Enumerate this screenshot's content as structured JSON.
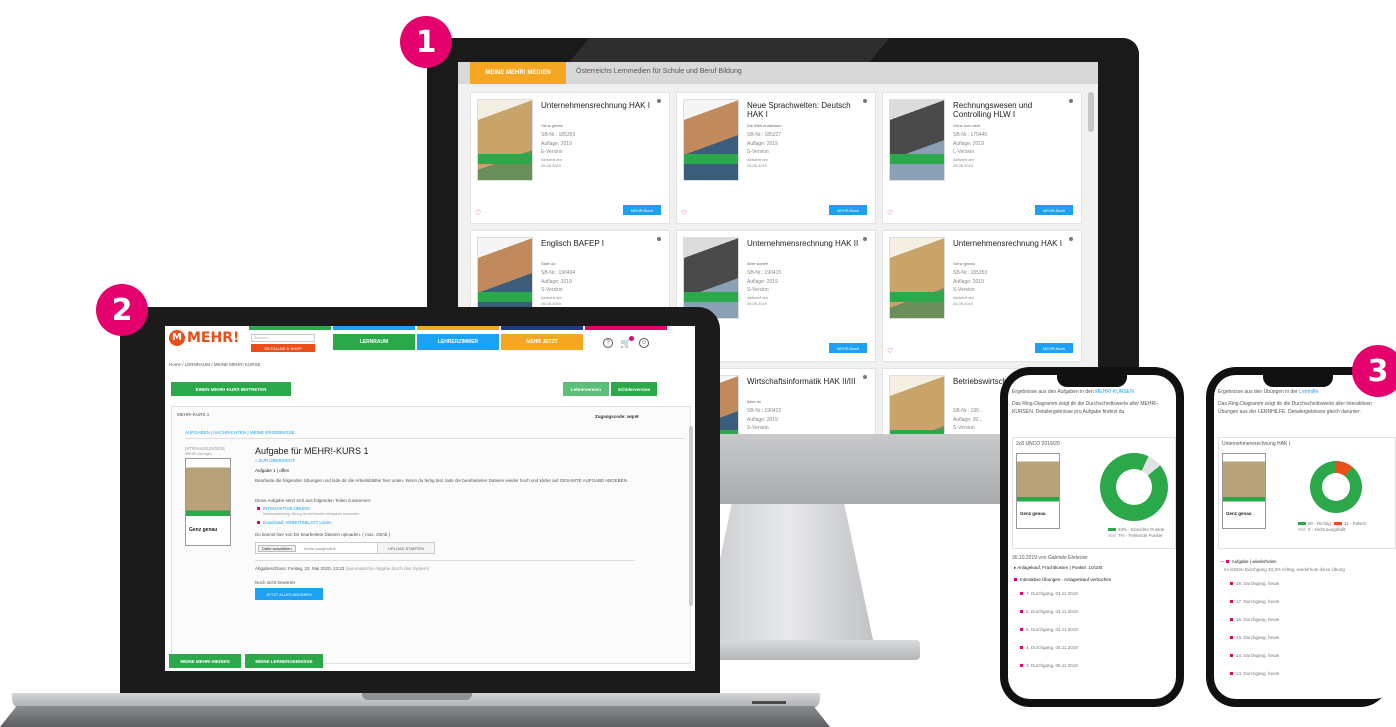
{
  "badges": [
    "1",
    "2",
    "3"
  ],
  "colors": {
    "accent_magenta": "#e4006d",
    "brand_orange": "#e94e1b",
    "green": "#2aa84a",
    "blue": "#1da1f2",
    "yellow": "#f5a623",
    "navy": "#1e3a8a",
    "pink": "#e4006d"
  },
  "monitor": {
    "tab_label": "MEINE MEHR! MEDIEN",
    "tab_text": "Österreichs Lernmedien für Schule und Beruf Bildung",
    "cards": [
      {
        "title": "Unternehmensrechnung HAK I",
        "subtitle": "Genz genau",
        "sbnr": "SB-Nr.: 185353",
        "auflage": "Auflage: 2019",
        "version": "E-Version",
        "aktiviert": "Aktiviert am",
        "date": "26.06.2019",
        "button": "MEHR-Buch",
        "cover": "teal"
      },
      {
        "title": "Neue Sprachwelten: Deutsch HAK I",
        "subtitle": "Die Welt entdecken",
        "sbnr": "SB-Nr.: 185227",
        "auflage": "Auflage: 2019",
        "version": "S-Version",
        "aktiviert": "Aktiviert am",
        "date": "26.06.2019",
        "button": "MEHR-Buch",
        "cover": "people"
      },
      {
        "title": "Rechnungswesen und Controlling HLW I",
        "subtitle": "Genz und mehr",
        "sbnr": "SB-Nr.: 175445",
        "auflage": "Auflage: 2019",
        "version": "L-Version",
        "aktiviert": "Aktiviert am",
        "date": "26.06.2019",
        "button": "MEHR-Buch",
        "cover": "dark"
      },
      {
        "title": "Englisch BAFEP I",
        "subtitle": "Start Up",
        "sbnr": "SB-Nr.: 190404",
        "auflage": "Auflage: 2019",
        "version": "S-Version",
        "aktiviert": "Aktiviert am",
        "date": "26.06.2019",
        "button": "",
        "cover": "people"
      },
      {
        "title": "Unternehmensrechnung HAK II",
        "subtitle": "Aber sicher!",
        "sbnr": "SB-Nr.: 190415",
        "auflage": "Auflage: 2019",
        "version": "S-Version",
        "aktiviert": "Aktiviert am",
        "date": "26.06.2019",
        "button": "MEHR-Buch",
        "cover": "dark"
      },
      {
        "title": "Unternehmensrechnung HAK I",
        "subtitle": "Genz genau",
        "sbnr": "SB-Nr.: 185353",
        "auflage": "Auflage: 2019",
        "version": "S-Version",
        "aktiviert": "Aktiviert am",
        "date": "26.06.2019",
        "button": "MEHR-Buch",
        "cover": "teal"
      },
      {
        "title": "",
        "subtitle": "",
        "sbnr": "",
        "auflage": "",
        "version": "",
        "aktiviert": "",
        "date": "",
        "button": "",
        "cover": "dark"
      },
      {
        "title": "Wirtschaftsinformatik HAK II/III",
        "subtitle": "Alles ist",
        "sbnr": "SB-Nr.: 190422",
        "auflage": "Auflage: 2019",
        "version": "S-Version",
        "aktiviert": "",
        "date": "",
        "button": "",
        "cover": "people"
      },
      {
        "title": "Betriebswirtschaft ...",
        "subtitle": "",
        "sbnr": "SB-Nr.: 190...",
        "auflage": "Auflage: 20...",
        "version": "S-Version",
        "aktiviert": "Aktiviert am",
        "date": "22.06.2019",
        "button": "",
        "cover": "teal"
      }
    ]
  },
  "laptop": {
    "logo": "MEHR!",
    "logo_mark": "M",
    "search_placeholder": "Suchen...",
    "shop_button": "SB-FALLBE & SHOP",
    "nav": [
      "LERNRAUM",
      "LEHRERZIMMER",
      "MEHR JETZT"
    ],
    "breadcrumb": "Home / LERNRAUM / MEINE MEHR! KURSE",
    "join_button": "EINEN MEHR!-KURS BEITRETEN",
    "toggle_left": "Lehrerversion",
    "toggle_right": "Schülerversion",
    "course_name": "MEHR!-KURS 1",
    "access_code": "Zugangscode: wqn9",
    "subtabs": "AUFGABEN | NACHRICHTEN | MEINE ERGEBNISSE",
    "img_alt": "[STRAHLEUNGEN]",
    "img_sub": "MEHR!-Übungen",
    "task_title": "Aufgabe für MEHR!-KURS 1",
    "back_link": "« ZUR ÜBERSICHT",
    "task_status": "Aufgabe 1 | offen",
    "task_desc": "Bearbeite die folgenden Übungen und lade dir die Arbeitsblätter hier unten. Wenn du fertig bist, lade die bearbeiteten Dateien wieder hoch und klicke auf GESAMTE AUFGABE ABGEBEN.",
    "task_parts": "Diese Aufgabe setzt sich aus folgenden Teilen zusammen:",
    "part1": "INTERAKTIVE ÜBUNG",
    "part1_sub": "Nachbearbeitung: Übung ist dort bereits erfolgreich bearbeitet",
    "part2": "Download: ARBEITSBLATT Lösen",
    "upload_hint": "Du kannst hier von Dir bearbeitete Dateien uploaden. ( max. 20mb )",
    "file_button": "Datei auswählen",
    "file_value": "Keine ausgewählt",
    "upload_button": "UPLOAD STARTEN",
    "due": "Abgabeschluss: Freitag, 22. Mai 2020, 13:23",
    "due_note": "(automatische Abgabe durch das System)",
    "graded": "Noch nicht bewertet",
    "submit_button": "JETZT ALLES ABGEBEN",
    "bottom_buttons": [
      "MEINE MEHR!-MEDIEN",
      "MEINE LERNERGEBNISSE"
    ],
    "cover_title": "Genz genau"
  },
  "phone1": {
    "header": "Ergebnisse aus den Aufgaben in den",
    "header_link": "MEHR!-KURSEN",
    "intro": "Das Ring-Diagramm zeigt dir die Durchschnittswerte aller MEHR!-KURSEN. Detailergebnisse pro Aufgabe findest du",
    "section": "2c8 UNCO 2019/20",
    "legend1": "93% - Erreichte Punkte",
    "legend2": "7% - Fehlende Punkte",
    "cover_title": "Genz genau",
    "teacher_line": "30.10.2019 von Gabriele Ehrlecier",
    "task": "Anlagekauf, Frachtkosten",
    "task_points": "Punkte: 10/100",
    "exercise": "Interaktive Übungen - Anlagenkauf verbuchen",
    "percent_green": 93,
    "durchgaenge": [
      "7. Durchgang, 04.11.2019",
      "6. Durchgang, 04.11.2019",
      "5. Durchgang, 04.11.2019",
      "4. Durchgang, 04.11.2019",
      "3. Durchgang, 06.11.2019"
    ]
  },
  "phone2": {
    "header": "Ergebnisse aus den Übungen in der",
    "header_link": "Lernhilfe",
    "intro": "Das Ring-Diagramm zeigt dir die Durchschnittswerte aller interaktiven Übungen aus der LERNHILFE. Detailergebnisse gleich darunter.",
    "section": "Unternehmensrechnung HAK I",
    "legend1": "90 - Richtig",
    "legend2": "11 - Falsch",
    "legend3": "0 - Nicht ausgefüllt",
    "cover_title": "Genz genau",
    "task": "Aufgabe | wiederholen",
    "task_note": "Im letzten Durchgang 33,3% richtig, wiederhole diese Übung",
    "percent_green": 89,
    "durchgaenge": [
      "18. Durchgang, heute",
      "17. Durchgang, heute",
      "16. Durchgang, heute",
      "15. Durchgang, heute",
      "14. Durchgang, heute",
      "13. Durchgang, heute"
    ]
  }
}
